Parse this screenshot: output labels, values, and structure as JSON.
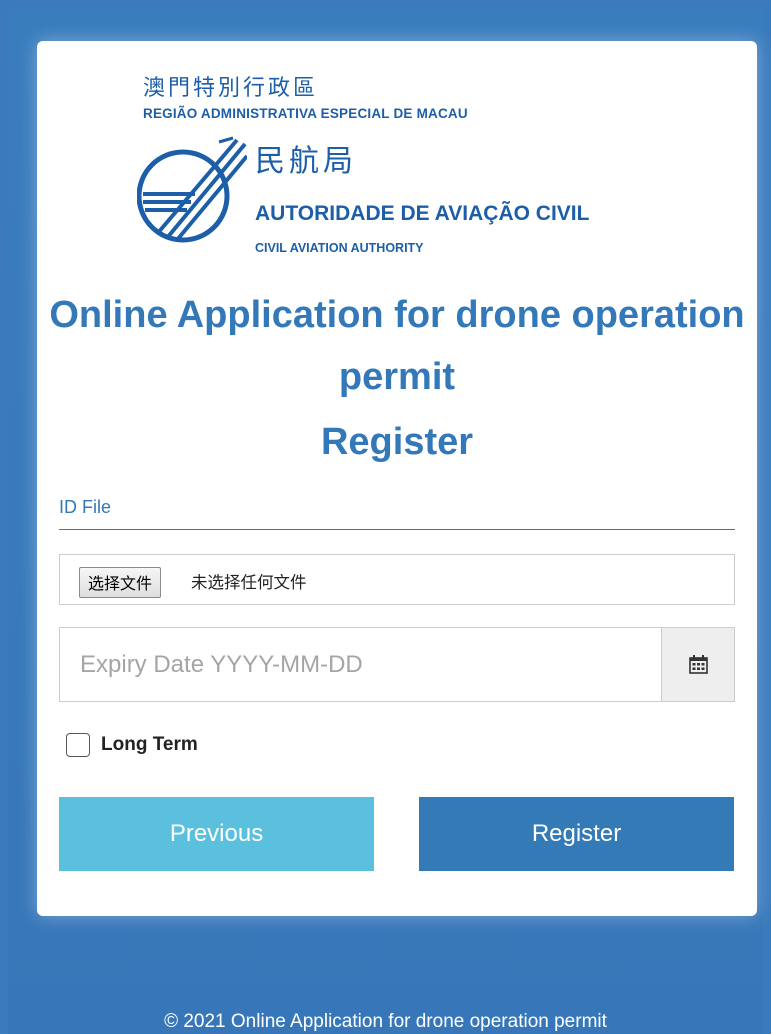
{
  "logo": {
    "cn_region": "澳門特別行政區",
    "pt_region": "REGIÃO ADMINISTRATIVA ESPECIAL DE MACAU",
    "cn_authority": "民航局",
    "pt_authority": "AUTORIDADE DE AVIAÇÃO CIVIL",
    "en_authority": "CIVIL AVIATION AUTHORITY",
    "color": "#1d5ea8"
  },
  "page": {
    "title": "Online Application for drone operation permit",
    "subtitle": "Register"
  },
  "form": {
    "section_label": "ID File",
    "file_button_label": "选择文件",
    "file_status": "未选择任何文件",
    "expiry_placeholder": "Expiry Date YYYY-MM-DD",
    "expiry_value": "",
    "calendar_icon": "calendar-icon",
    "long_term_label": "Long Term",
    "long_term_checked": false
  },
  "buttons": {
    "previous_label": "Previous",
    "register_label": "Register",
    "previous_color": "#5bc0de",
    "register_color": "#337ab7"
  },
  "footer": {
    "text": "© 2021 Online Application for drone operation permit"
  },
  "theme": {
    "background": "#3b7bbd",
    "accent": "#3378b8"
  }
}
